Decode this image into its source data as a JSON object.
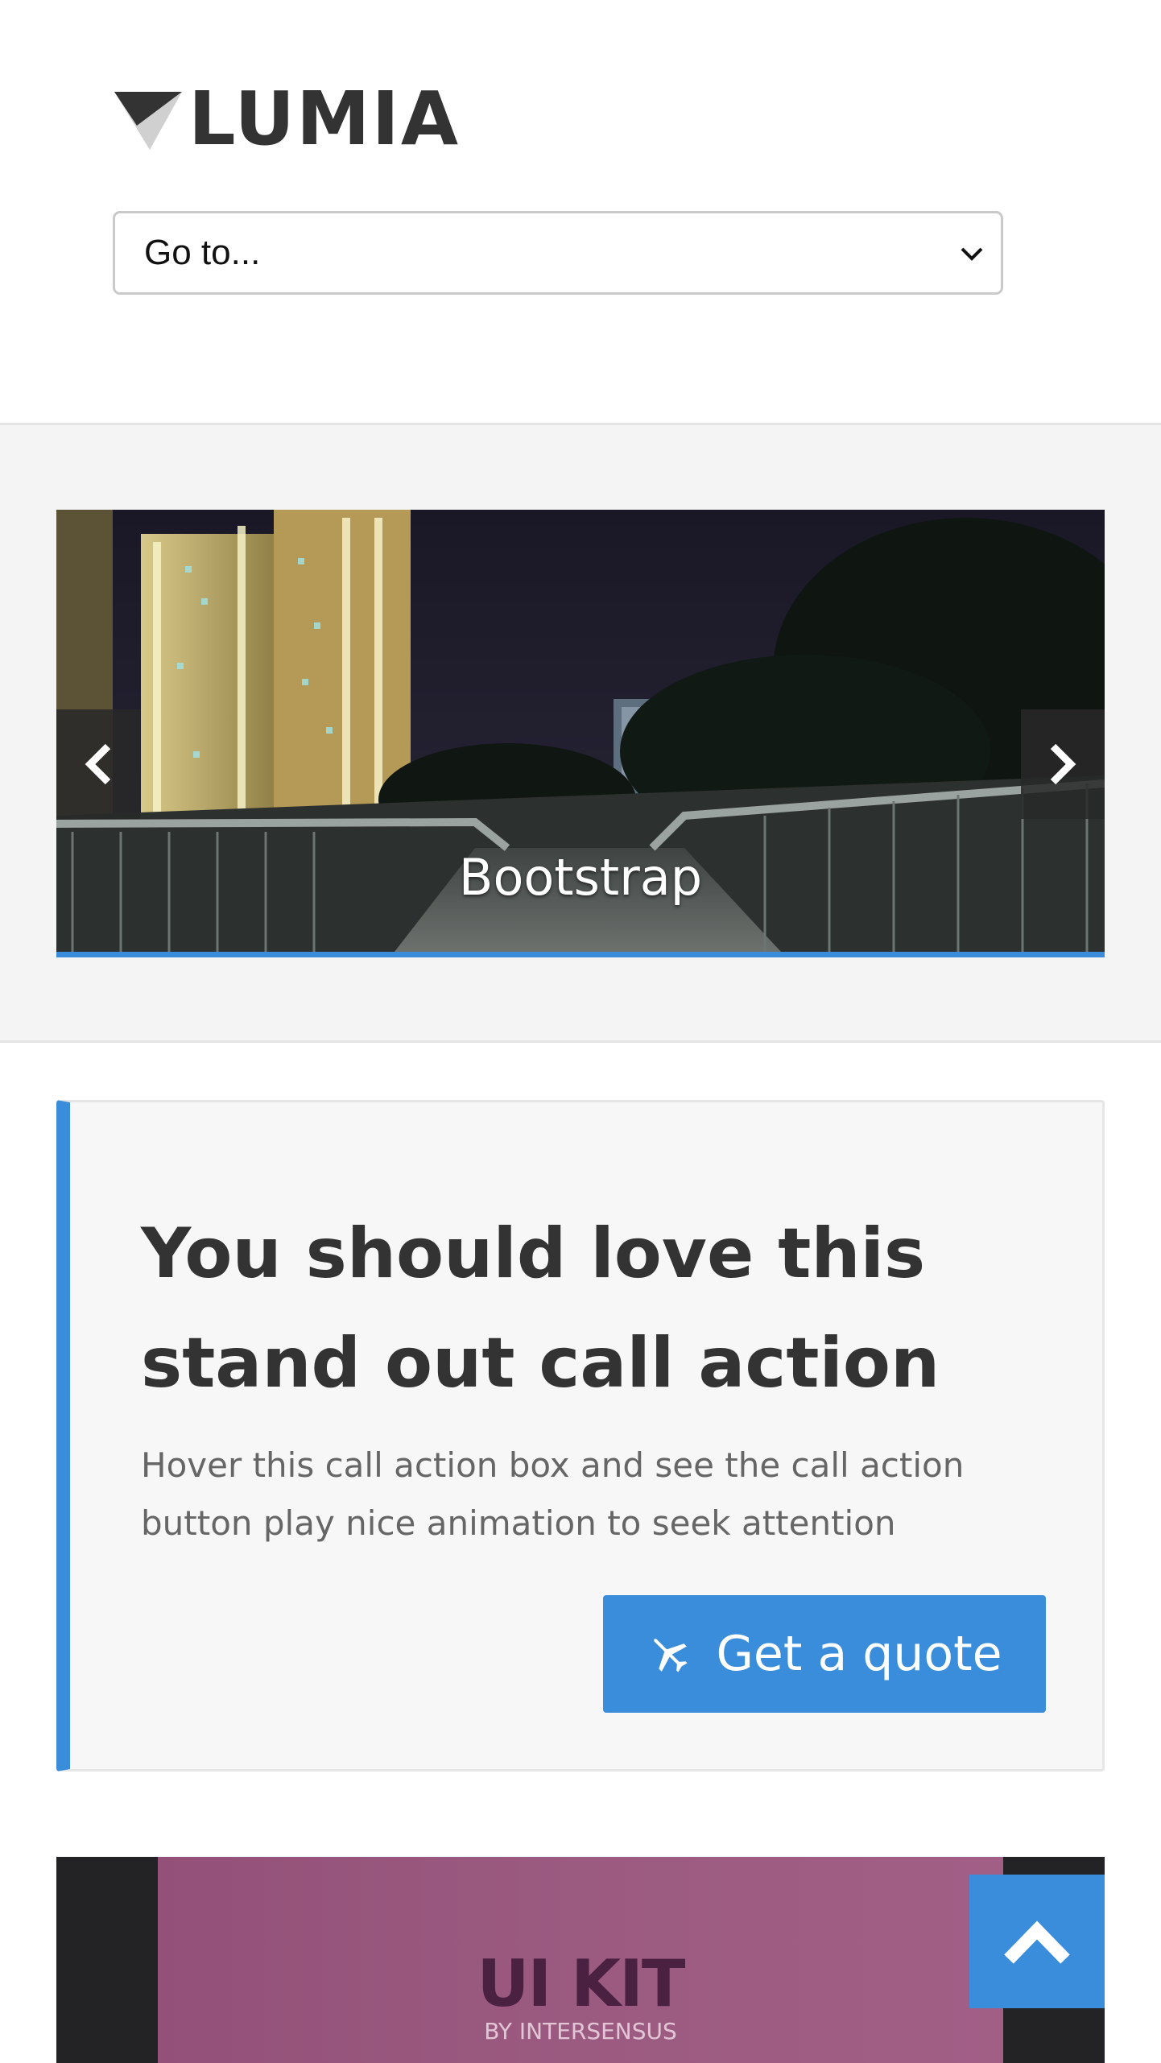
{
  "header": {
    "logo_text": "LUMIA",
    "nav_select": {
      "selected": "Go to..."
    }
  },
  "slider": {
    "caption": "Bootstrap",
    "prev_icon": "chevron-left-icon",
    "next_icon": "chevron-right-icon",
    "accent_color": "#3a8ddb"
  },
  "call_action": {
    "title": "You should love this stand out call action",
    "description": "Hover this call action box and see the call action button play nice animation to seek attention",
    "button_label": "Get a quote",
    "button_icon": "airplane-icon",
    "accent_color": "#3a8ddb"
  },
  "portfolio": {
    "item_title": "UI KIT",
    "item_subtitle": "BY INTERSENSUS"
  },
  "back_to_top": {
    "icon": "chevron-up-icon"
  }
}
